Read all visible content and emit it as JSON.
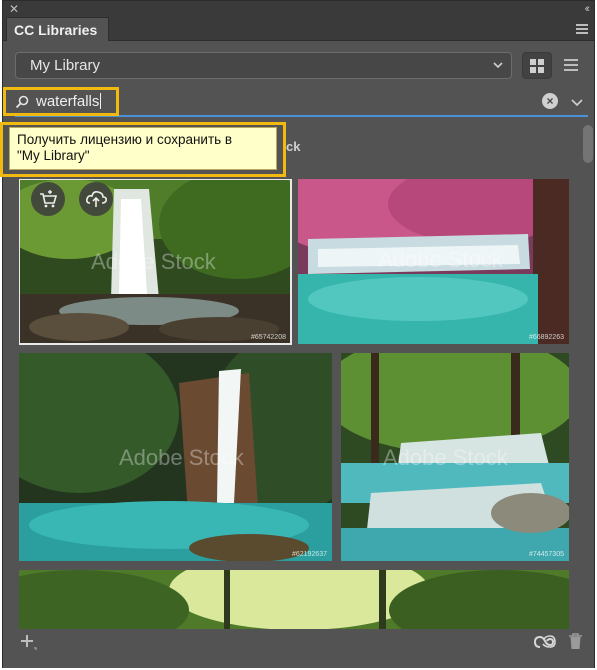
{
  "panel": {
    "title": "CC Libraries",
    "close_glyph": "✕",
    "collapse_glyph": "‹‹"
  },
  "library_select": {
    "value": "My Library"
  },
  "view_toggle": {
    "active": "grid"
  },
  "search": {
    "value": "waterfalls"
  },
  "tooltip": {
    "line1": "Получить лицензию и сохранить в",
    "line2": "\"My Library\""
  },
  "section_label": "ck",
  "results": {
    "watermark_text": "Adobe Stock",
    "items": [
      {
        "id": "#65742208",
        "selected": true,
        "actions": [
          "license-and-save-icon",
          "cloud-save-icon"
        ]
      },
      {
        "id": "#66892263",
        "selected": false
      },
      {
        "id": "#62192637",
        "selected": false
      },
      {
        "id": "#74457305",
        "selected": false
      },
      {
        "id": "",
        "selected": false
      }
    ]
  },
  "icons": {
    "add": "add-icon",
    "creative_cloud": "creative-cloud-icon",
    "trash": "trash-icon"
  },
  "colors": {
    "panel_bg": "#535353",
    "highlight": "#f2b90f",
    "search_underline": "#4b91d7",
    "tooltip_bg": "#ffffc9"
  }
}
